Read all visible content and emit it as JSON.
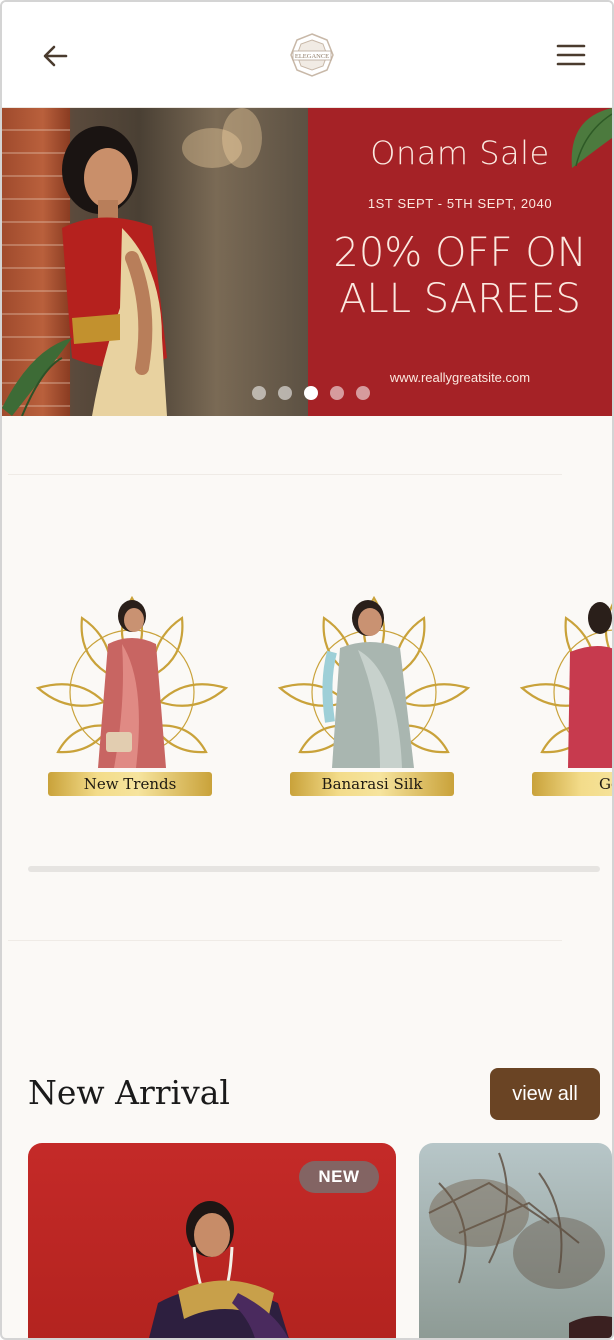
{
  "header": {
    "back_icon": "arrow-left-icon",
    "logo_text": "ELEGANCE",
    "menu_icon": "hamburger-menu-icon"
  },
  "banner": {
    "title": "Onam Sale",
    "dates": "1ST SEPT - 5TH SEPT, 2040",
    "offer_line1": "20% OFF ON",
    "offer_line2": "ALL SAREES",
    "website": "www.reallygreatsite.com",
    "slides_count": 5,
    "active_slide": 3,
    "accent_color": "#a52226"
  },
  "categories": [
    {
      "label": "New Trends"
    },
    {
      "label": "Banarasi Silk"
    },
    {
      "label": "Geo"
    }
  ],
  "new_arrival": {
    "title": "New Arrival",
    "view_all_label": "view all",
    "products": [
      {
        "badge": "NEW"
      },
      {
        "badge": ""
      }
    ],
    "button_color": "#6a4424"
  }
}
